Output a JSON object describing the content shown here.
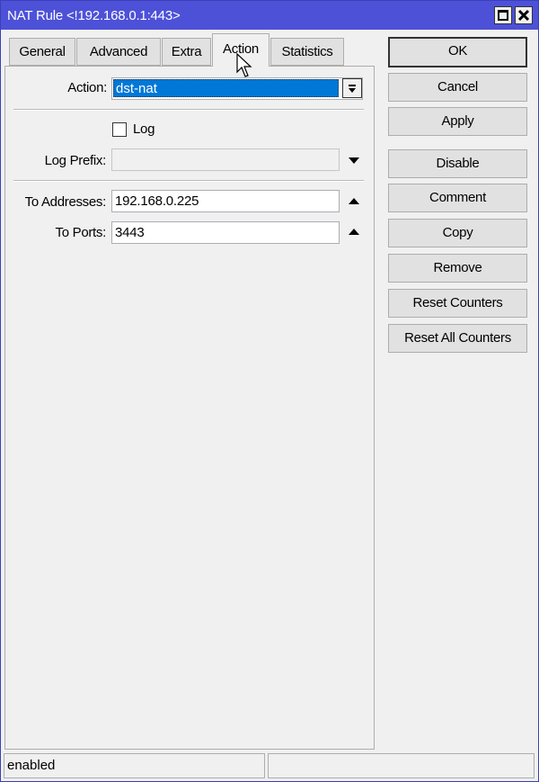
{
  "window": {
    "title": "NAT Rule <!192.168.0.1:443>"
  },
  "tabs": [
    {
      "label": "General"
    },
    {
      "label": "Advanced"
    },
    {
      "label": "Extra"
    },
    {
      "label": "Action"
    },
    {
      "label": "Statistics"
    }
  ],
  "active_tab": "Action",
  "form": {
    "action_label": "Action:",
    "action_value": "dst-nat",
    "log_label": "Log",
    "log_checked": false,
    "log_prefix_label": "Log Prefix:",
    "log_prefix_value": "",
    "to_addresses_label": "To Addresses:",
    "to_addresses_value": "192.168.0.225",
    "to_ports_label": "To Ports:",
    "to_ports_value": "3443"
  },
  "buttons": {
    "ok": "OK",
    "cancel": "Cancel",
    "apply": "Apply",
    "disable": "Disable",
    "comment": "Comment",
    "copy": "Copy",
    "remove": "Remove",
    "reset_counters": "Reset Counters",
    "reset_all_counters": "Reset All Counters"
  },
  "status": {
    "state": "enabled",
    "secondary": ""
  },
  "colors": {
    "titlebar": "#4d51d8",
    "selection": "#0078d7"
  }
}
